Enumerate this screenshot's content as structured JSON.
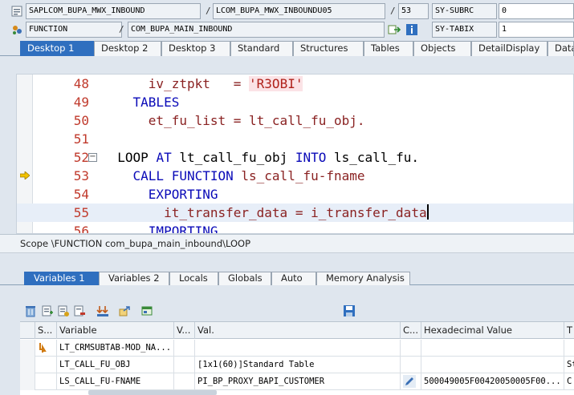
{
  "status": {
    "program": "SAPLCOM_BUPA_MWX_INBOUND",
    "include": "LCOM_BUPA_MWX_INBOUNDU05",
    "line": "53",
    "var1_name": "SY-SUBRC",
    "var1_value": "0",
    "event_type": "FUNCTION",
    "event_name": "COM_BUPA_MAIN_INBOUND",
    "var2_name": "SY-TABIX",
    "var2_value": "1",
    "sep": "/"
  },
  "desktop_tabs": [
    "Desktop 1",
    "Desktop 2",
    "Desktop 3",
    "Standard",
    "Structures",
    "Tables",
    "Objects",
    "DetailDisplay",
    "Data"
  ],
  "code": {
    "lines": [
      {
        "num": "48",
        "parts": [
          [
            "var",
            "      iv_ztpkt   = "
          ],
          [
            "str",
            "'R3OBI'"
          ]
        ]
      },
      {
        "num": "49",
        "parts": [
          [
            "kw",
            "    TABLES"
          ]
        ]
      },
      {
        "num": "50",
        "parts": [
          [
            "var",
            "      et_fu_list = lt_call_fu_obj."
          ]
        ]
      },
      {
        "num": "51",
        "parts": [
          [
            "var",
            ""
          ]
        ]
      },
      {
        "num": "52",
        "parts": [
          [
            "blk",
            "  LOOP "
          ],
          [
            "kw",
            "AT "
          ],
          [
            "blk",
            "lt_call_fu_obj "
          ],
          [
            "kw",
            "INTO "
          ],
          [
            "blk",
            "ls_call_fu."
          ]
        ]
      },
      {
        "num": "53",
        "parts": [
          [
            "kw",
            "    CALL FUNCTION "
          ],
          [
            "var",
            "ls_call_fu-fname"
          ]
        ]
      },
      {
        "num": "54",
        "parts": [
          [
            "kw",
            "      EXPORTING"
          ]
        ]
      },
      {
        "num": "55",
        "parts": [
          [
            "var",
            "        it_transfer_data = i_transfer_data"
          ]
        ]
      },
      {
        "num": "56",
        "parts": [
          [
            "kw",
            "      IMPORTING"
          ]
        ]
      }
    ]
  },
  "scope": "Scope \\FUNCTION com_bupa_main_inbound\\LOOP",
  "variable_tabs": [
    "Variables 1",
    "Variables 2",
    "Locals",
    "Globals",
    "Auto",
    "Memory Analysis"
  ],
  "grid": {
    "headers": [
      "S...",
      "Variable",
      "V...",
      "Val.",
      "C...",
      "Hexadecimal Value",
      "T"
    ],
    "rows": [
      {
        "variable": "LT_CRMSUBTAB-MOD_NA...",
        "value": "",
        "hex": "",
        "t": ""
      },
      {
        "variable": "LT_CALL_FU_OBJ",
        "value": "[1x1(60)]Standard Table",
        "hex": "",
        "t": "St"
      },
      {
        "variable": "LS_CALL_FU-FNAME",
        "value": "PI_BP_PROXY_BAPI_CUSTOMER",
        "hex": "500049005F00420050005F00...",
        "t": "C"
      }
    ]
  },
  "colors": {
    "active_tab": "#2f6fbf",
    "keyword": "#0a0ab8",
    "line_number": "#c0392b",
    "string_bg": "#fbe3e6"
  }
}
